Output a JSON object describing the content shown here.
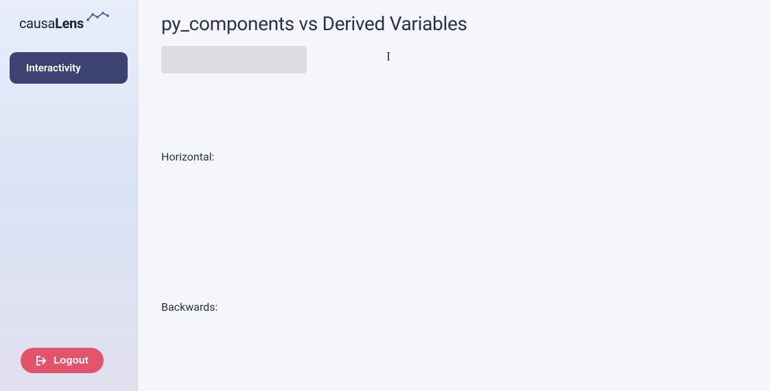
{
  "brand": {
    "logo_prefix": "causa",
    "logo_bold": "Lens"
  },
  "sidebar": {
    "nav_item": "Interactivity",
    "logout_label": "Logout"
  },
  "main": {
    "title": "py_components vs Derived Variables",
    "input_value": "",
    "input_placeholder": "",
    "horizontal_label": "Horizontal:",
    "backwards_label": "Backwards:"
  },
  "colors": {
    "nav_bg": "#3d4371",
    "logout_bg": "#e2536c",
    "main_bg": "#f4f6fc",
    "input_bg": "#dcdde3"
  }
}
